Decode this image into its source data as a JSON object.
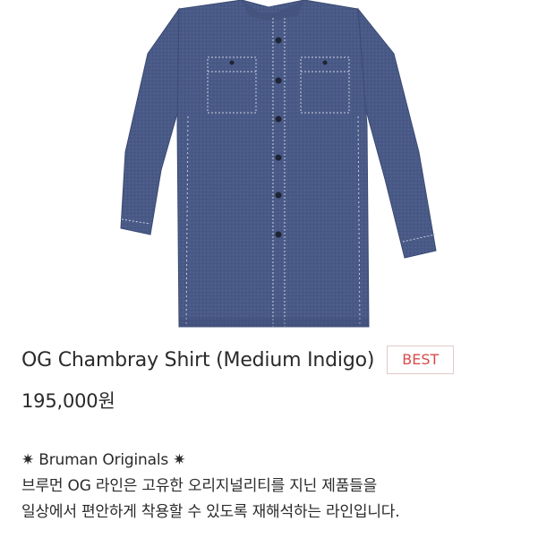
{
  "product": {
    "image_alt_icon": "shirt-icon",
    "title": "OG Chambray Shirt (Medium Indigo)",
    "badge": "BEST",
    "price": "195,000원"
  },
  "description": {
    "lines": [
      "✷ Bruman Originals ✷",
      "브루먼 OG 라인은 고유한 오리지널리티를 지닌 제품들을",
      "일상에서 편안하게 착용할 수 있도록 재해석하는 라인입니다."
    ]
  },
  "colors": {
    "shirt": "#4a5a86",
    "shirt_dark": "#3b4a73",
    "stitch": "#c9cfdf",
    "badge_text": "#d94b4b",
    "badge_border": "#e3c9c9",
    "text": "#2a2a2a"
  }
}
